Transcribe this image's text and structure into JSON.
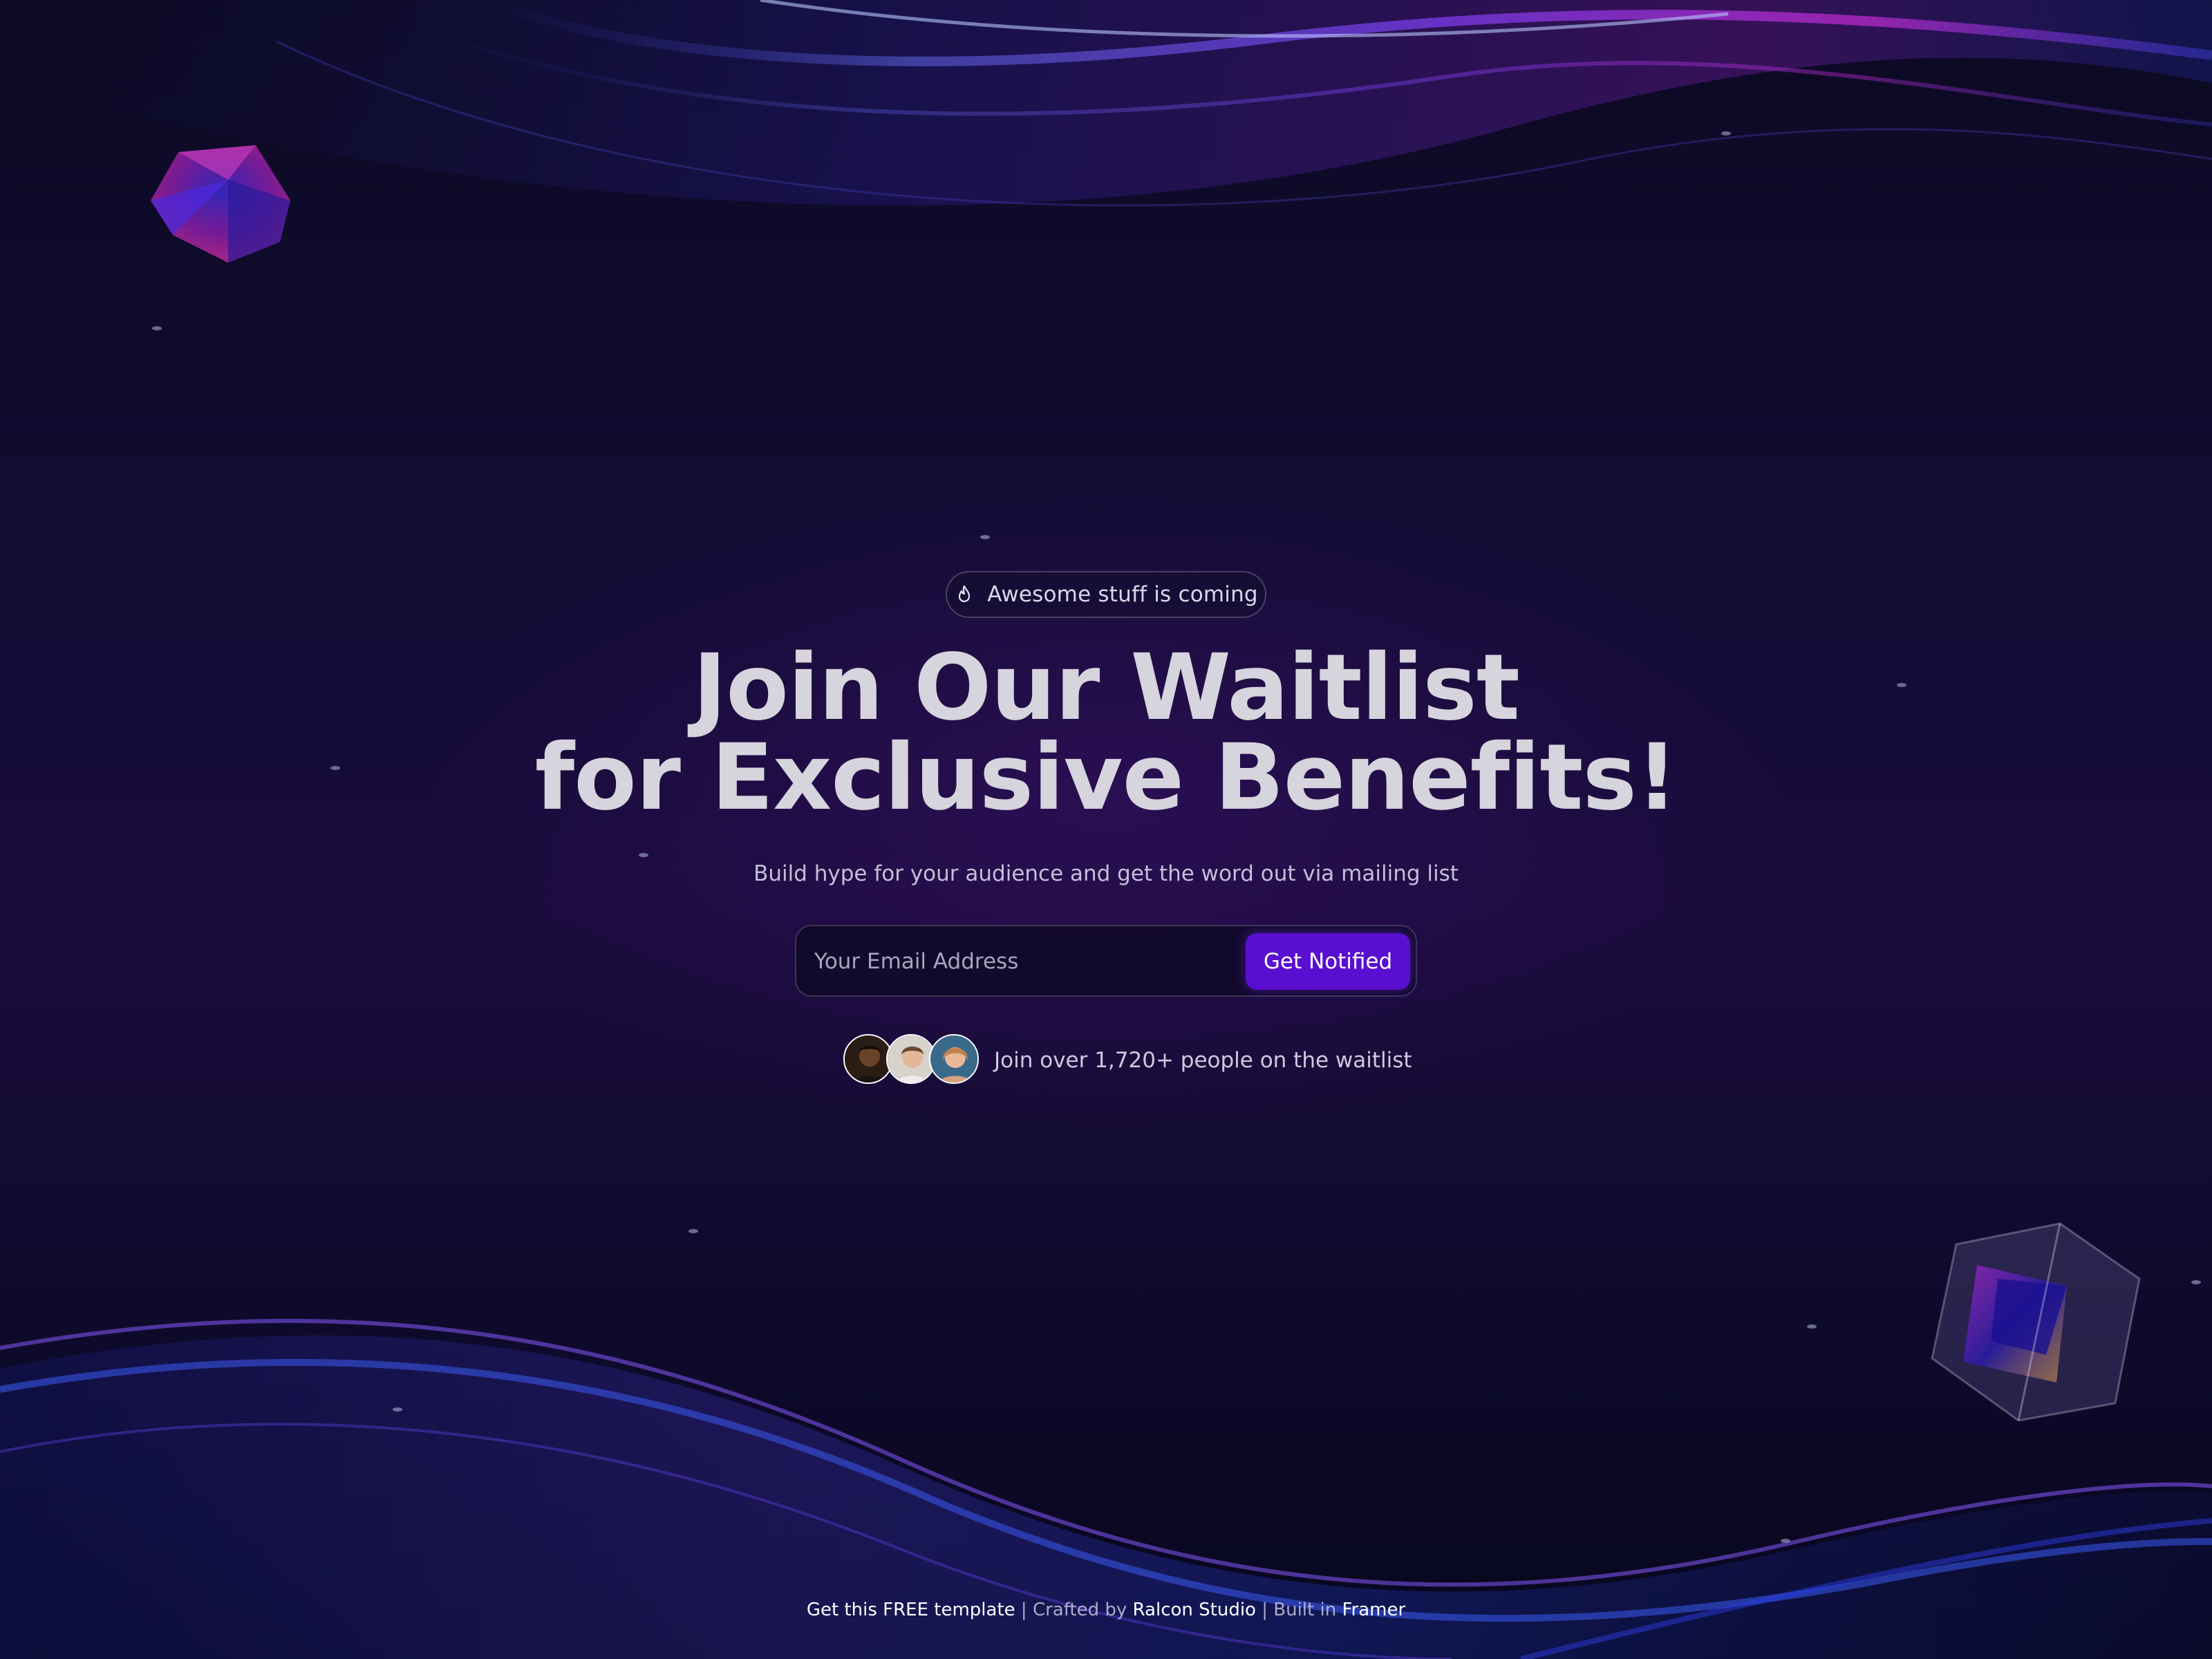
{
  "badge": {
    "icon": "flame-icon",
    "text": "Awesome stuff is coming"
  },
  "hero": {
    "title_line1": "Join Our Waitlist",
    "title_line2": "for Exclusive Benefits!",
    "subtitle": "Build hype for your audience and get the word out via mailing list"
  },
  "form": {
    "email_placeholder": "Your Email Address",
    "email_value": "",
    "button_label": "Get Notified"
  },
  "social_proof": {
    "text": "Join over 1,720+ people on the waitlist",
    "avatar_count": 3
  },
  "footer": {
    "template_link": "Get this FREE template",
    "separator": "|",
    "crafted_prefix": "Crafted by",
    "studio_link": "Ralcon Studio",
    "built_prefix": "Built in",
    "framer_link": "Framer"
  },
  "colors": {
    "background": "#0e0a2a",
    "accent": "#5a0fd0",
    "wave_purple": "#8a2be2",
    "wave_blue": "#3a4cf0"
  }
}
